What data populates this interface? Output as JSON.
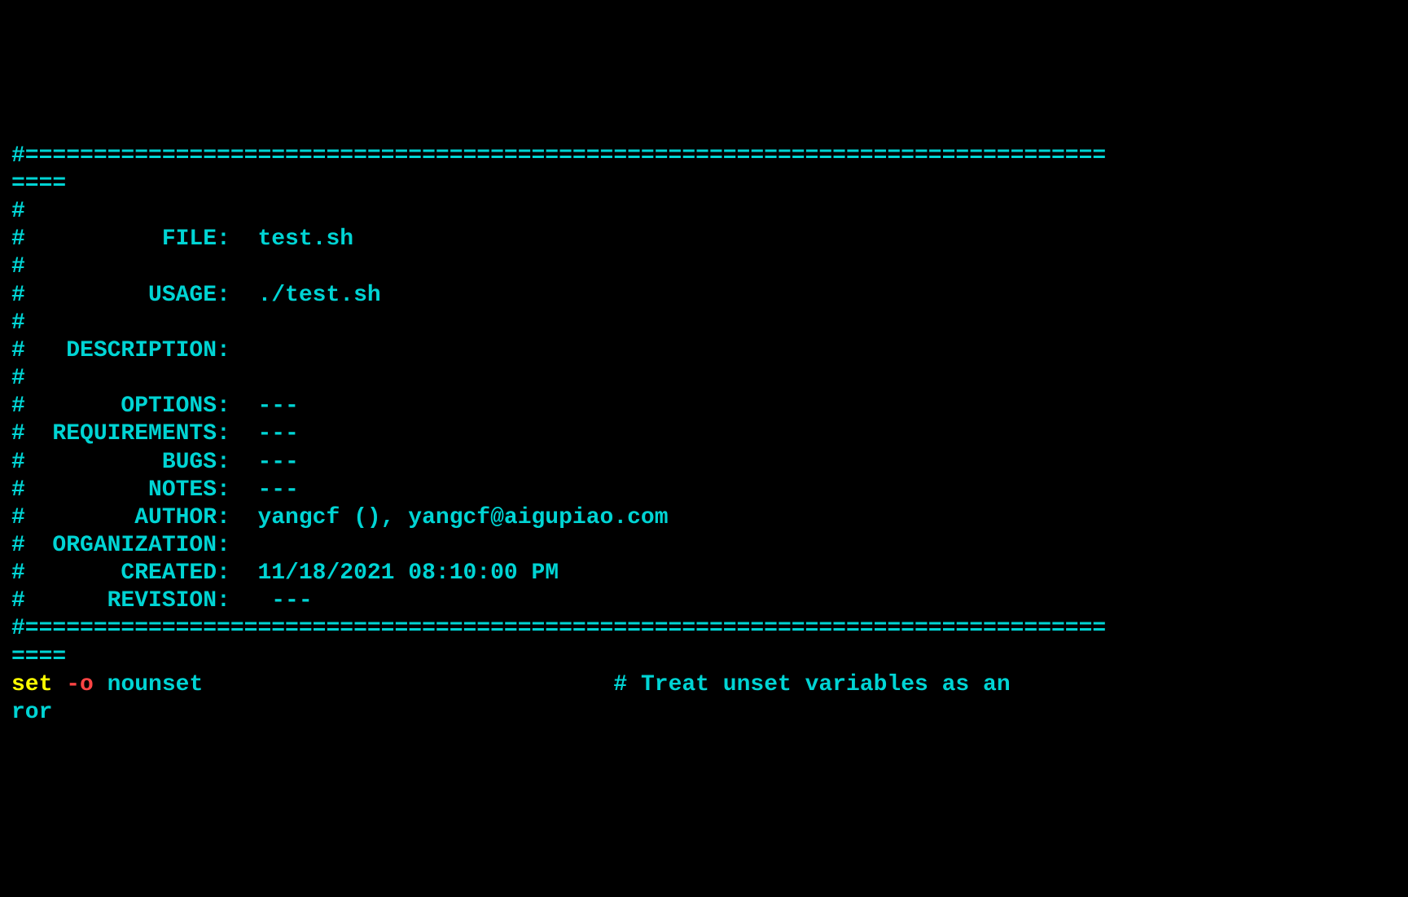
{
  "header": {
    "separator_top": "#===============================================================================",
    "separator_wrap": "====",
    "hash": "#",
    "file_line": "#          FILE:  test.sh",
    "usage_line": "#         USAGE:  ./test.sh",
    "description_line": "#   DESCRIPTION:  ",
    "options_line": "#       OPTIONS:  ---",
    "requirements_line": "#  REQUIREMENTS:  ---",
    "bugs_line": "#          BUGS:  ---",
    "notes_line": "#         NOTES:  ---",
    "author_line": "#        AUTHOR:  yangcf (), yangcf@aigupiao.com",
    "organization_line": "#  ORGANIZATION:  ",
    "created_line": "#       CREATED:  11/18/2021 08:10:00 PM",
    "revision_line": "#      REVISION:   ---",
    "separator_bottom": "#===============================================================================",
    "blank": ""
  },
  "code": {
    "set_keyword": "set",
    "option_flag": " -o",
    "nounset": " nounset",
    "spacing": "                              ",
    "comment_text": "# Treat unset variables as an",
    "ror_wrap": "ror"
  }
}
